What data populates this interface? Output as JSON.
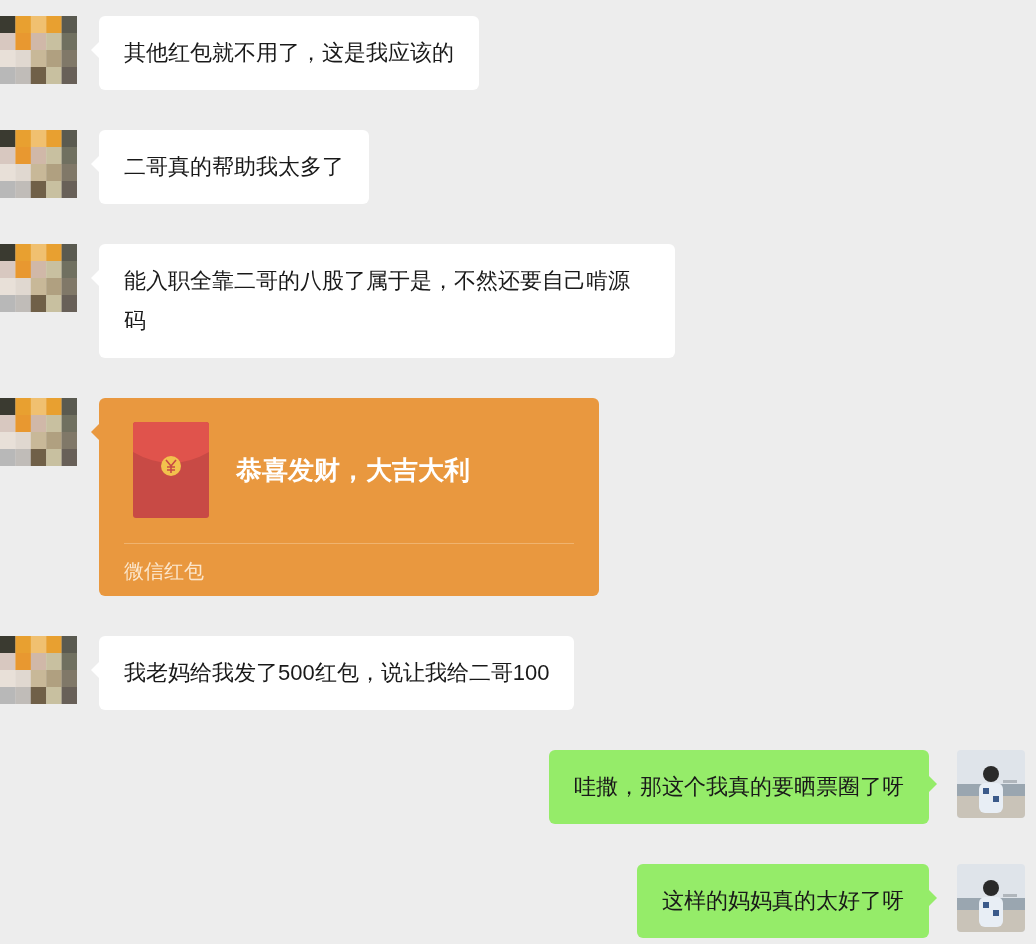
{
  "messages": [
    {
      "kind": "text",
      "outgoing": false,
      "text": "其他红包就不用了，这是我应该的"
    },
    {
      "kind": "text",
      "outgoing": false,
      "text": "二哥真的帮助我太多了"
    },
    {
      "kind": "text",
      "outgoing": false,
      "text": "能入职全靠二哥的八股了属于是，不然还要自己啃源码"
    },
    {
      "kind": "red_packet",
      "outgoing": false,
      "title": "恭喜发财，大吉大利",
      "label": "微信红包"
    },
    {
      "kind": "text",
      "outgoing": false,
      "text": "我老妈给我发了500红包，说让我给二哥100"
    },
    {
      "kind": "text",
      "outgoing": true,
      "text": "哇撒，那这个我真的要晒票圈了呀"
    },
    {
      "kind": "text",
      "outgoing": true,
      "text": "这样的妈妈真的太好了呀"
    }
  ]
}
